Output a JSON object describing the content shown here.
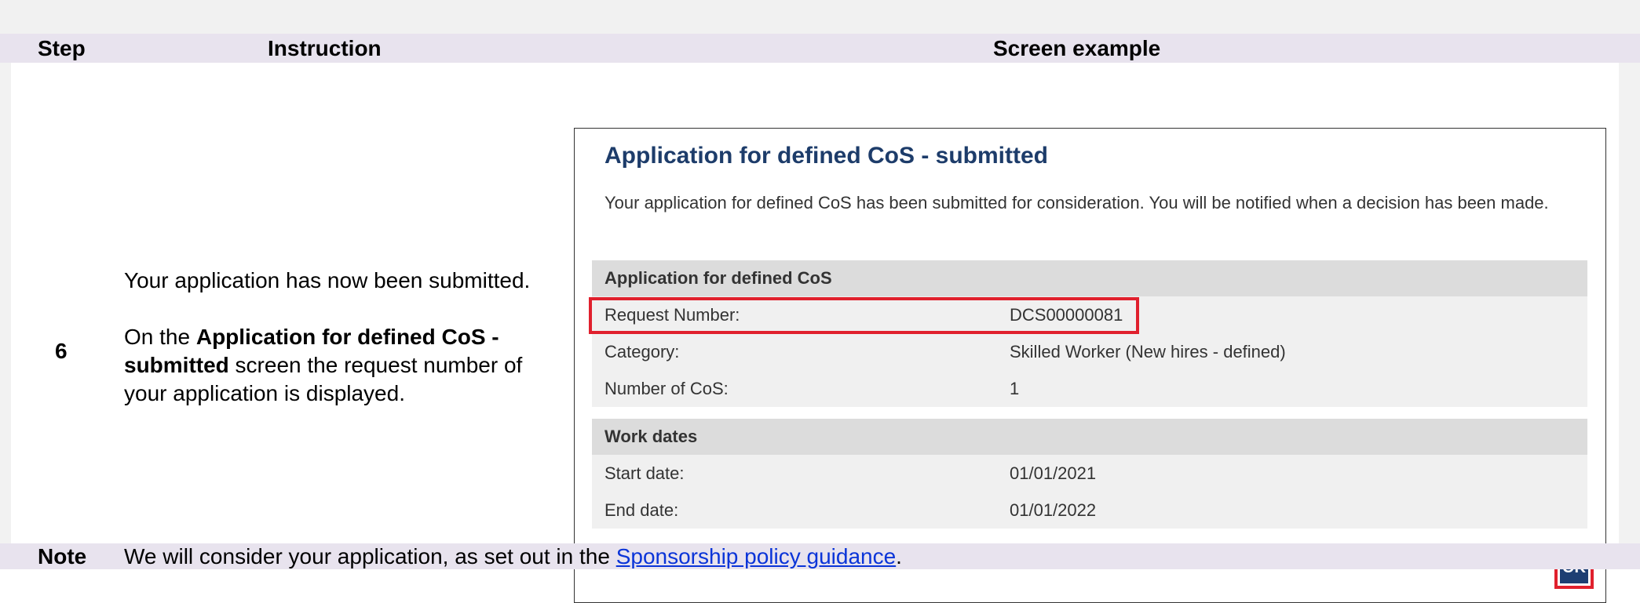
{
  "header": {
    "step": "Step",
    "instruction": "Instruction",
    "screen_example": "Screen example"
  },
  "step_number": "6",
  "instruction": {
    "para1": "Your application has now been submitted.",
    "para2_prefix": "On the ",
    "para2_bold": "Application for defined CoS - submitted",
    "para2_suffix": " screen the request number of your application is displayed."
  },
  "screen": {
    "title": "Application for defined CoS - submitted",
    "description": "Your application for defined CoS has been submitted for consideration. You will be notified when a decision has been made.",
    "sections": [
      {
        "heading": "Application for defined CoS",
        "rows": [
          {
            "label": "Request Number:",
            "value": "DCS00000081"
          },
          {
            "label": "Category:",
            "value": "Skilled Worker (New hires - defined)"
          },
          {
            "label": "Number of CoS:",
            "value": "1"
          }
        ]
      },
      {
        "heading": "Work dates",
        "rows": [
          {
            "label": "Start date:",
            "value": "01/01/2021"
          },
          {
            "label": "End date:",
            "value": "01/01/2022"
          }
        ]
      }
    ],
    "ok_button": "OK"
  },
  "note": {
    "label": "Note",
    "text_prefix": "We will consider your application, as set out in the ",
    "link_text": "Sponsorship policy guidance",
    "text_suffix": "."
  },
  "colors": {
    "header_band": "#e8e3ee",
    "title_blue": "#1d3c6a",
    "highlight_red": "#e0202d",
    "ok_button": "#1d3f73",
    "link_blue": "#0a34d8"
  }
}
